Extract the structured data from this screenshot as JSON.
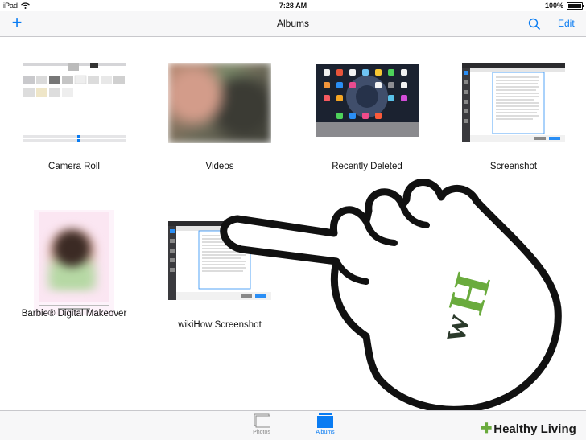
{
  "status_bar": {
    "device": "iPad",
    "time": "7:28 AM",
    "battery": "100%"
  },
  "nav": {
    "title": "Albums",
    "edit_label": "Edit"
  },
  "albums": [
    {
      "name": "Camera Roll"
    },
    {
      "name": "Videos"
    },
    {
      "name": "Recently Deleted"
    },
    {
      "name": "Screenshot"
    },
    {
      "name": "Barbie® Digital Makeover"
    },
    {
      "name": "wikiHow Screenshot"
    }
  ],
  "tabs": [
    {
      "label": "Photos"
    },
    {
      "label": "Albums"
    }
  ],
  "colors": {
    "accent": "#0a7cf2",
    "logo_green": "#6aab3d",
    "logo_dark": "#2b3a2b"
  },
  "watermark": {
    "logo": "wH",
    "text": "Healthy Living"
  }
}
